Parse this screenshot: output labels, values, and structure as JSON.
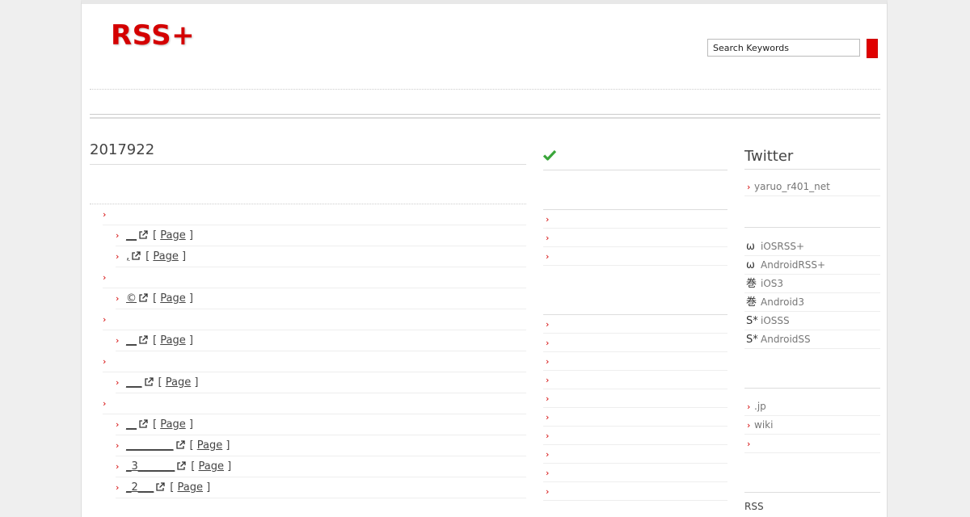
{
  "header": {
    "logo": "RSS+",
    "search_placeholder": "Search Keywords"
  },
  "main": {
    "title": "2017922",
    "sections": [
      {
        "links": [
          {
            "text": "__",
            "page_label": "Page"
          },
          {
            "text": ",",
            "page_label": "Page"
          }
        ]
      },
      {
        "links": [
          {
            "text": "©",
            "page_label": "Page"
          }
        ]
      },
      {
        "links": [
          {
            "text": "__",
            "page_label": "Page"
          }
        ]
      },
      {
        "links": [
          {
            "text": "___",
            "page_label": "Page"
          }
        ]
      },
      {
        "links": [
          {
            "text": "__",
            "page_label": "Page"
          },
          {
            "text": "_________",
            "page_label": "Page"
          },
          {
            "text": "_3_______",
            "page_label": "Page"
          },
          {
            "text": "_2___",
            "page_label": "Page"
          }
        ]
      }
    ]
  },
  "middle": {
    "group_a_count": 3,
    "group_b_count": 10
  },
  "sidebar": {
    "twitter_title": "Twitter",
    "twitter_user": "yaruo_r401_net",
    "apps": [
      {
        "glyph": "ω",
        "label": "iOSRSS+"
      },
      {
        "glyph": "ω",
        "label": "AndroidRSS+"
      },
      {
        "glyph": "巻",
        "label": "iOS3"
      },
      {
        "glyph": "巻",
        "label": "Android3"
      },
      {
        "glyph": "S*",
        "label": "iOSSS"
      },
      {
        "glyph": "S*",
        "label": "AndroidSS"
      }
    ],
    "links": [
      ".jp",
      "wiki",
      ""
    ],
    "rss_label": "RSS"
  },
  "colors": {
    "accent": "#d40000",
    "check": "#3aa63a"
  }
}
